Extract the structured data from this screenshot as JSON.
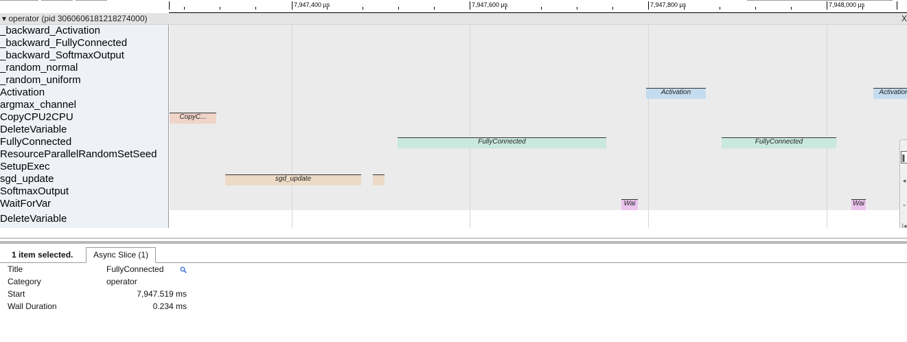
{
  "ruler": {
    "labels": [
      "7,947,400 µs",
      "7,947,600 µs",
      "7,947,800 µs",
      "7,948,000 µs"
    ]
  },
  "process": {
    "title": "▾ operator (pid 3060606181218274000)",
    "close_label": "X"
  },
  "tracks": [
    "_backward_Activation",
    "_backward_FullyConnected",
    "_backward_SoftmaxOutput",
    "_random_normal",
    "_random_uniform",
    "Activation",
    "argmax_channel",
    "CopyCPU2CPU",
    "DeleteVariable",
    "FullyConnected",
    "ResourceParallelRandomSetSeed",
    "SetupExec",
    "sgd_update",
    "SoftmaxOutput",
    "WaitForVar",
    "DeleteVariable"
  ],
  "slices": {
    "activation_1": "Activation",
    "activation_2": "Activation",
    "copy": "CopyC...",
    "fc_1": "FullyConnected",
    "fc_2": "FullyConnected",
    "sgd": "sgd_update",
    "sgd_small": "",
    "wait_1": "Wai",
    "wait_2": "Wai"
  },
  "colors": {
    "activation": "#c4dcef",
    "copy": "#f0d4c8",
    "fully_connected": "#c9e8df",
    "sgd_update": "#ecdac6",
    "wait_for_var": "#ebc4ee"
  },
  "panel": {
    "selected_count": "1 item selected.",
    "tab_label": "Async Slice (1)"
  },
  "details": {
    "title_key": "Title",
    "title_value": "FullyConnected",
    "category_key": "Category",
    "category_value": "operator",
    "start_key": "Start",
    "start_value": "7,947.519 ms",
    "duration_key": "Wall Duration",
    "duration_value": "0.234 ms"
  },
  "icons": {
    "search": "magnifier-icon",
    "side_controls": [
      "select-icon",
      "pan-icon",
      "zoom-icon",
      "timing-icon"
    ]
  }
}
